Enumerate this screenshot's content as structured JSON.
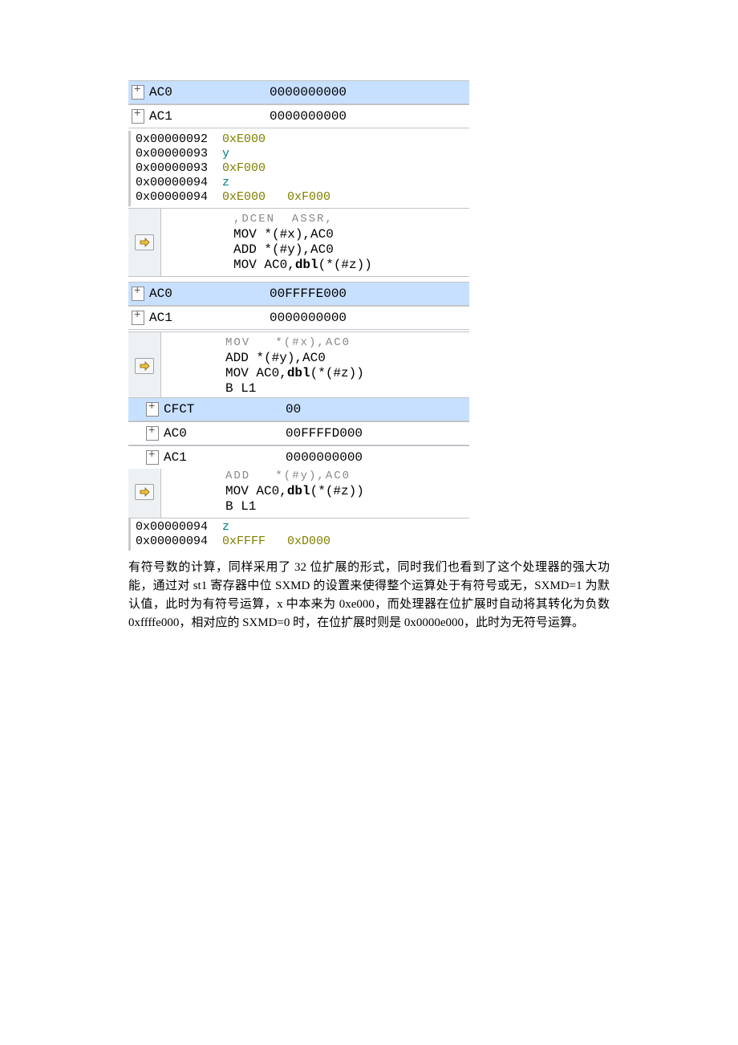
{
  "panel1": {
    "rows": [
      {
        "name": "AC0",
        "value": "0000000000",
        "highlight": true
      },
      {
        "name": "AC1",
        "value": "0000000000",
        "highlight": false
      }
    ]
  },
  "mem1": {
    "lines": [
      {
        "addr": "0x00000092",
        "rest": "0xE000"
      },
      {
        "addr": "0x00000093",
        "rest": "y",
        "is_symbol": true
      },
      {
        "addr": "0x00000093",
        "rest": "0xF000"
      },
      {
        "addr": "0x00000094",
        "rest": "z",
        "is_symbol": true
      },
      {
        "addr": "0x00000094",
        "rest": "0xE000   0xF000"
      }
    ]
  },
  "code1": {
    "faint": ",DCEN  ASSR,",
    "lines": [
      "MOV *(#x),AC0",
      "ADD *(#y),AC0",
      "MOV AC0,dbl(*(#z))"
    ]
  },
  "panel2": {
    "rows": [
      {
        "name": "AC0",
        "value": "00FFFFE000",
        "highlight": true
      },
      {
        "name": "AC1",
        "value": "0000000000",
        "highlight": false
      }
    ]
  },
  "code2": {
    "faint": "MOV   *(#x),AC0",
    "lines": [
      "ADD *(#y),AC0",
      "MOV AC0,dbl(*(#z))",
      "B L1"
    ]
  },
  "panel3": {
    "rows": [
      {
        "name": "CFCT",
        "value": "00",
        "highlight": true
      },
      {
        "name": "AC0",
        "value": "00FFFFD000",
        "highlight": false
      },
      {
        "name": "AC1",
        "value": "0000000000",
        "highlight": false
      }
    ]
  },
  "code3": {
    "faint": "ADD   *(#y),AC0",
    "lines": [
      "MOV AC0,dbl(*(#z))",
      "B L1"
    ]
  },
  "mem2": {
    "lines": [
      {
        "addr": "0x00000094",
        "rest": "z",
        "is_symbol": true
      },
      {
        "addr": "0x00000094",
        "rest": "0xFFFF   0xD000"
      }
    ]
  },
  "paragraph": "有符号数的计算，同样采用了 32 位扩展的形式，同时我们也看到了这个处理器的强大功能，通过对 st1 寄存器中位 SXMD 的设置来使得整个运算处于有符号或无，SXMD=1 为默认值，此时为有符号运算，x 中本来为 0xe000，而处理器在位扩展时自动将其转化为负数 0xffffe000，相对应的 SXMD=0 时，在位扩展时则是 0x0000e000，此时为无符号运算。"
}
